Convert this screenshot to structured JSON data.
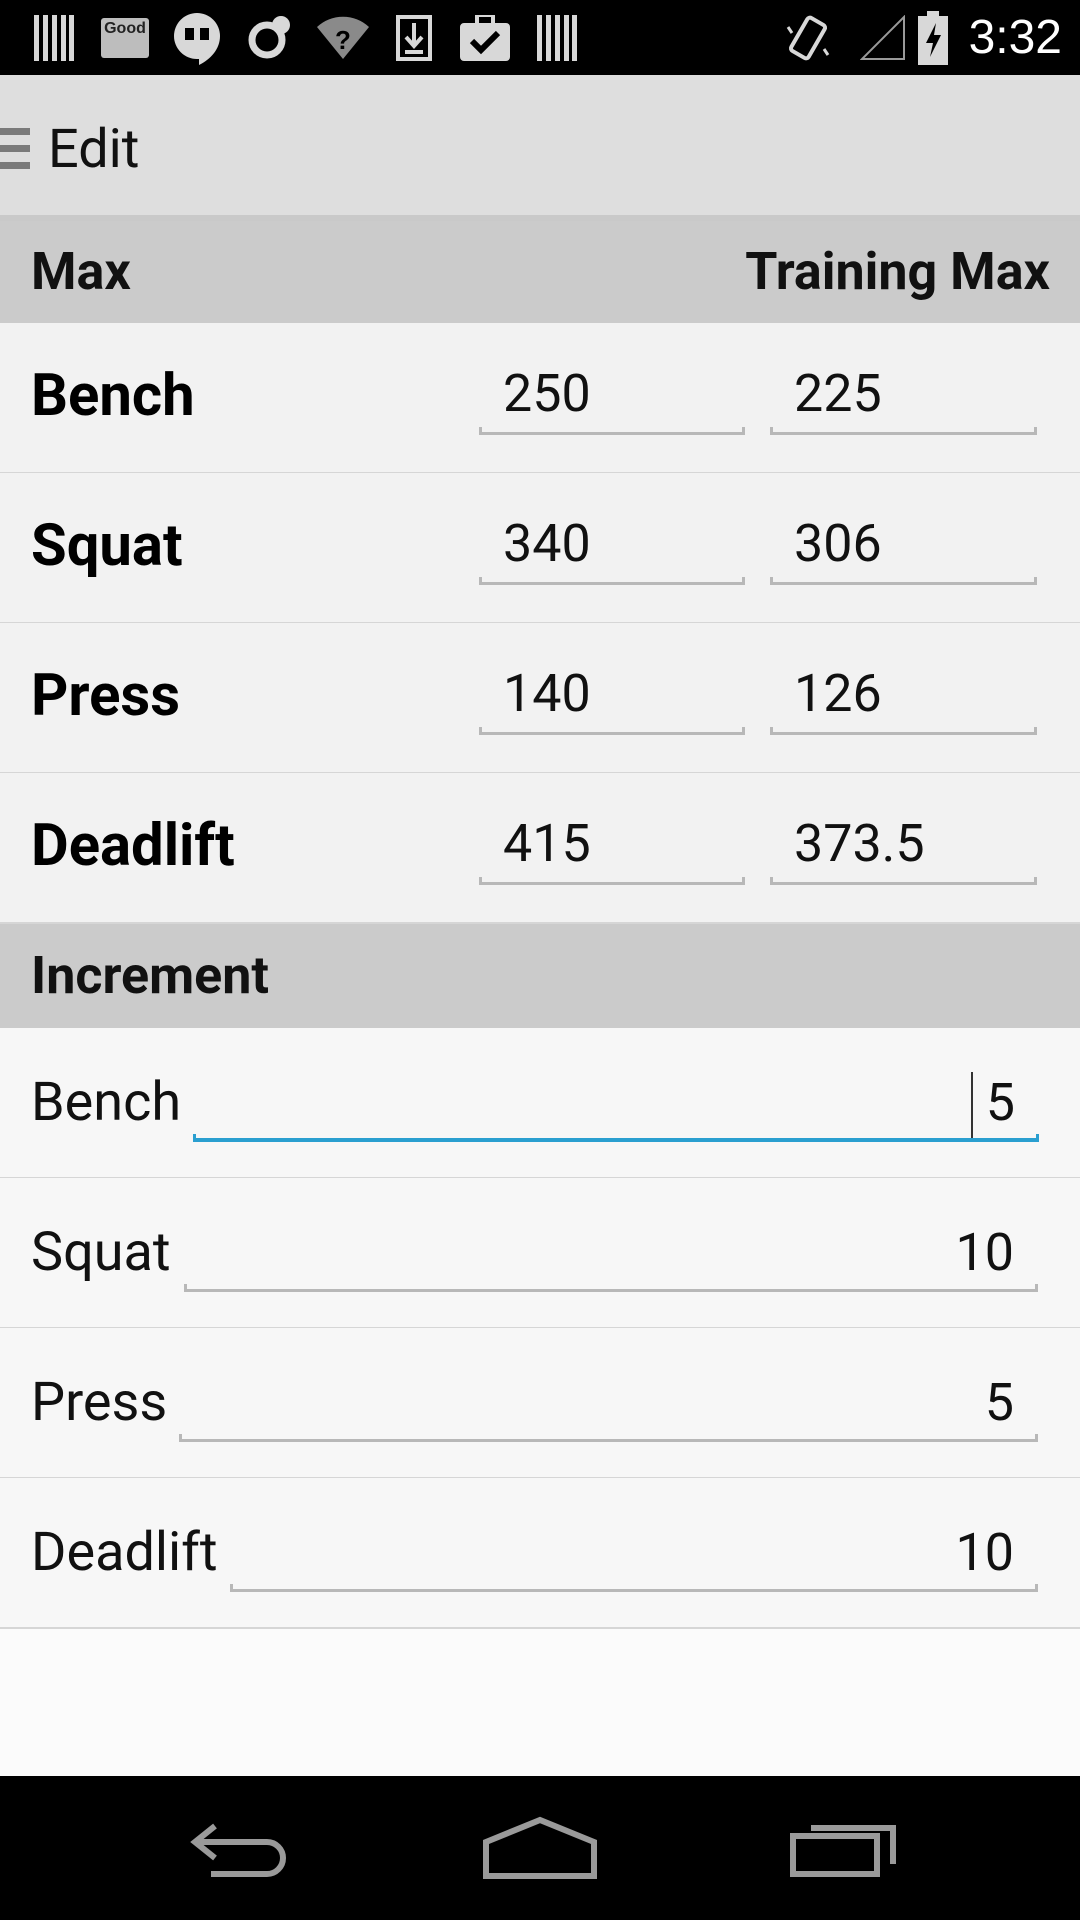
{
  "status_bar": {
    "time": "3:32",
    "notification_icons": [
      "barcode-icon",
      "good-app-icon",
      "hangouts-icon",
      "sync-icon",
      "wifi-question-icon",
      "download-icon",
      "task-check-icon",
      "barcode-icon"
    ],
    "good_label": "Good",
    "system_icons": [
      "vibrate-icon",
      "no-signal-icon",
      "battery-charging-icon"
    ]
  },
  "action_bar": {
    "title": "Edit",
    "drawer_icon": "drawer-menu-icon"
  },
  "max_section": {
    "header_left": "Max",
    "header_right": "Training Max",
    "rows": [
      {
        "lift": "Bench",
        "max": "250",
        "training_max": "225"
      },
      {
        "lift": "Squat",
        "max": "340",
        "training_max": "306"
      },
      {
        "lift": "Press",
        "max": "140",
        "training_max": "126"
      },
      {
        "lift": "Deadlift",
        "max": "415",
        "training_max": "373.5"
      }
    ]
  },
  "increment_section": {
    "header": "Increment",
    "rows": [
      {
        "lift": "Bench",
        "value": "5",
        "focused": true
      },
      {
        "lift": "Squat",
        "value": "10"
      },
      {
        "lift": "Press",
        "value": "5"
      },
      {
        "lift": "Deadlift",
        "value": "10"
      }
    ]
  },
  "nav_bar": {
    "icons": [
      "back-icon",
      "home-icon",
      "recent-apps-icon"
    ]
  },
  "colors": {
    "accent": "#2a9fd0",
    "header_bg": "#cbcbcb",
    "action_bar_bg": "#dedede"
  }
}
